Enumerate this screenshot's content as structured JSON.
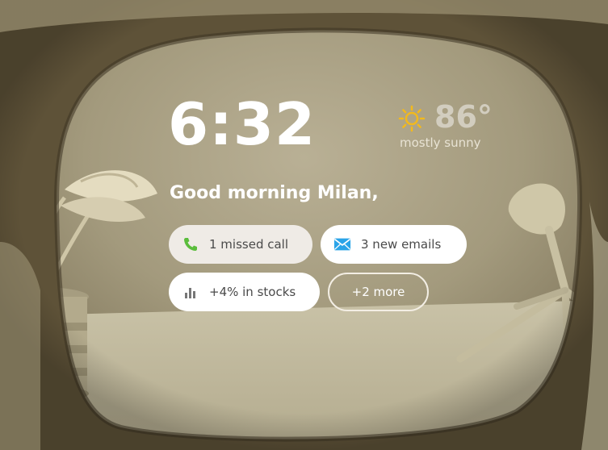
{
  "time": "6:32",
  "weather": {
    "icon": "sun-icon",
    "temperature": "86°",
    "condition": "mostly sunny",
    "icon_color": "#f2b91d"
  },
  "greeting": "Good morning Milan,",
  "notifications": [
    {
      "icon": "phone-icon",
      "label": "1 missed call",
      "icon_color": "#5bbd3c"
    },
    {
      "icon": "mail-icon",
      "label": "3 new emails",
      "icon_color": "#2aa4e8"
    },
    {
      "icon": "stocks-chart-icon",
      "label": "+4% in stocks",
      "icon_color": "#777777"
    }
  ],
  "more_button": {
    "label": "+2 more"
  }
}
